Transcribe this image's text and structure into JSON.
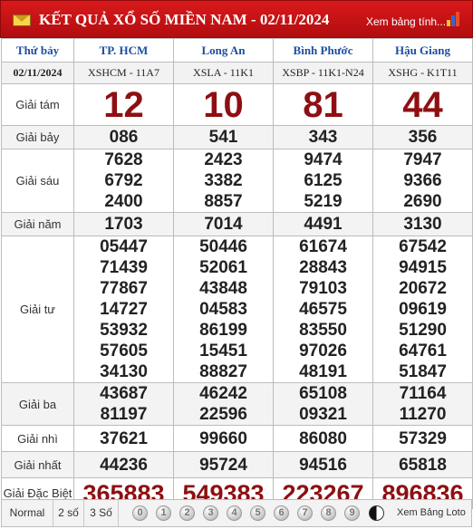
{
  "header": {
    "title": "KẾT QUẢ XỔ SỐ MIỀN NAM - 02/11/2024",
    "see_table": "Xem bảng tính...",
    "mail_icon": "envelope-icon",
    "chart_icon": "bar-chart-icon"
  },
  "table": {
    "day_label": "Thứ bảy",
    "date": "02/11/2024",
    "provinces": [
      {
        "name": "TP. HCM",
        "code": "XSHCM - 11A7"
      },
      {
        "name": "Long An",
        "code": "XSLA - 11K1"
      },
      {
        "name": "Bình Phước",
        "code": "XSBP - 11K1-N24"
      },
      {
        "name": "Hậu Giang",
        "code": "XSHG - K1T11"
      }
    ],
    "prizes": [
      {
        "label": "Giải tám",
        "values": [
          [
            "12"
          ],
          [
            "10"
          ],
          [
            "81"
          ],
          [
            "44"
          ]
        ]
      },
      {
        "label": "Giải bảy",
        "values": [
          [
            "086"
          ],
          [
            "541"
          ],
          [
            "343"
          ],
          [
            "356"
          ]
        ]
      },
      {
        "label": "Giải sáu",
        "values": [
          [
            "7628",
            "6792",
            "2400"
          ],
          [
            "2423",
            "3382",
            "8857"
          ],
          [
            "9474",
            "6125",
            "5219"
          ],
          [
            "7947",
            "9366",
            "2690"
          ]
        ]
      },
      {
        "label": "Giải năm",
        "values": [
          [
            "1703"
          ],
          [
            "7014"
          ],
          [
            "4491"
          ],
          [
            "3130"
          ]
        ]
      },
      {
        "label": "Giải tư",
        "values": [
          [
            "05447",
            "71439",
            "77867",
            "14727",
            "53932",
            "57605",
            "34130"
          ],
          [
            "50446",
            "52061",
            "43848",
            "04583",
            "86199",
            "15451",
            "88827"
          ],
          [
            "61674",
            "28843",
            "79103",
            "46575",
            "83550",
            "97026",
            "48191"
          ],
          [
            "67542",
            "94915",
            "20672",
            "09619",
            "51290",
            "64761",
            "51847"
          ]
        ]
      },
      {
        "label": "Giải ba",
        "values": [
          [
            "43687",
            "81197"
          ],
          [
            "46242",
            "22596"
          ],
          [
            "65108",
            "09321"
          ],
          [
            "71164",
            "11270"
          ]
        ]
      },
      {
        "label": "Giải nhì",
        "values": [
          [
            "37621"
          ],
          [
            "99660"
          ],
          [
            "86080"
          ],
          [
            "57329"
          ]
        ]
      },
      {
        "label": "Giải nhất",
        "values": [
          [
            "44236"
          ],
          [
            "95724"
          ],
          [
            "94516"
          ],
          [
            "65818"
          ]
        ]
      },
      {
        "label": "Giải Đặc Biệt",
        "values": [
          [
            "365883"
          ],
          [
            "549383"
          ],
          [
            "223267"
          ],
          [
            "896836"
          ]
        ]
      }
    ]
  },
  "footer": {
    "options": [
      "Normal",
      "2 số",
      "3 Số"
    ],
    "digits": [
      "0",
      "1",
      "2",
      "3",
      "4",
      "5",
      "6",
      "7",
      "8",
      "9"
    ],
    "yin_yang_icon": "yin-yang-icon",
    "loto_label": "Xem Bảng Loto"
  },
  "colors": {
    "title_bar": "#c41214",
    "header_text": "#1c4fa0",
    "highlight": "#8e0f12"
  }
}
